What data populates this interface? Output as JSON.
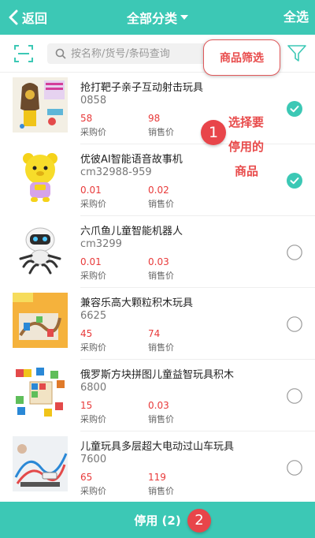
{
  "header": {
    "back_label": "返回",
    "category_label": "全部分类",
    "select_all_label": "全选",
    "bg_color": "#3cc8b5"
  },
  "search": {
    "placeholder": "按名称/货号/条码查询",
    "value": "",
    "filter_callout": "商品筛选"
  },
  "annotation": {
    "step1_number": "1",
    "step1_lines": [
      "选择要",
      "停用的",
      "商品"
    ],
    "step2_number": "2",
    "color": "#e8454a"
  },
  "products": [
    {
      "name": "抢打靶子亲子互动射击玩具",
      "code": "0858",
      "purchase_price": "58",
      "sale_price": "98",
      "purchase_label": "采购价",
      "sale_label": "销售价",
      "selected": true,
      "image": "shooting-target-toy-image"
    },
    {
      "name": "优彼AI智能语音故事机",
      "code": "cm32988-959",
      "purchase_price": "0.01",
      "sale_price": "0.02",
      "purchase_label": "采购价",
      "sale_label": "销售价",
      "selected": true,
      "image": "yellow-bear-story-machine-image"
    },
    {
      "name": "六爪鱼儿童智能机器人",
      "code": "cm3299",
      "purchase_price": "0.01",
      "sale_price": "0.03",
      "purchase_label": "采购价",
      "sale_label": "销售价",
      "selected": false,
      "image": "octopus-robot-image"
    },
    {
      "name": "兼容乐高大颗粒积木玩具",
      "code": "6625",
      "purchase_price": "45",
      "sale_price": "74",
      "purchase_label": "采购价",
      "sale_label": "销售价",
      "selected": false,
      "image": "building-blocks-track-image"
    },
    {
      "name": "俄罗斯方块拼图儿童益智玩具积木",
      "code": "6800",
      "purchase_price": "15",
      "sale_price": "0.03",
      "purchase_label": "采购价",
      "sale_label": "销售价",
      "selected": false,
      "image": "tetris-puzzle-blocks-image"
    },
    {
      "name": "儿童玩具多层超大电动过山车玩具",
      "code": "7600",
      "purchase_price": "65",
      "sale_price": "119",
      "purchase_label": "采购价",
      "sale_label": "销售价",
      "selected": false,
      "image": "roller-coaster-track-image"
    }
  ],
  "footer": {
    "deactivate_label": "停用 (2)"
  }
}
